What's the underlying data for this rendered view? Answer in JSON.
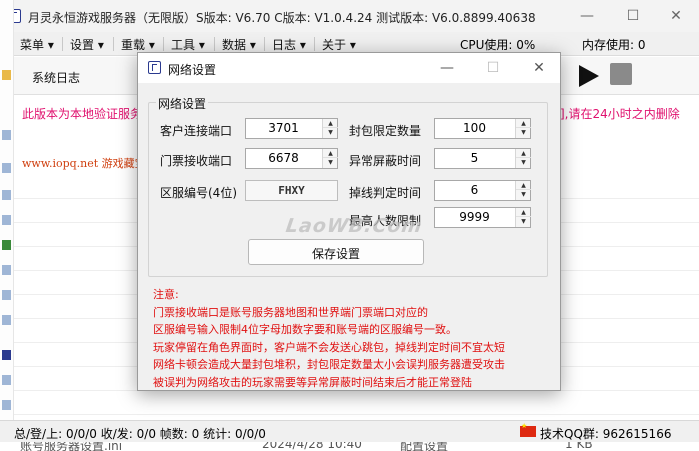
{
  "app": {
    "title": "月灵永恒游戏服务器（无限版）S版本: V6.70 C版本: V1.0.4.24 测试版本: V6.0.8899.40638"
  },
  "menu": {
    "items": [
      "菜单 ▾",
      "设置 ▾",
      "重载 ▾",
      "工具 ▾",
      "数据 ▾",
      "日志 ▾",
      "关于 ▾"
    ],
    "cpu": "CPU使用: 0%",
    "memory": "内存使用: 0"
  },
  "toolbar": {
    "system_log_tab": "系统日志"
  },
  "log": {
    "notice_left": "此版本为本地验证服务",
    "notice_right": "],请在24小时之内删除",
    "site": "www.iopq.net 游戏藏宝"
  },
  "status": {
    "left": "总/登/上: 0/0/0  收/发: 0/0  帧数: 0  统计: 0/0/0",
    "qq": "技术QQ群: 962615166"
  },
  "background_row": {
    "name": "账号服务器设置.ini",
    "date": "2024/4/28 10:40",
    "type": "配置设置",
    "size": "1 KB"
  },
  "dialog": {
    "title": "网络设置",
    "group_label": "网络设置",
    "fields": {
      "client_port": {
        "label": "客户连接端口",
        "value": "3701"
      },
      "ticket_port": {
        "label": "门票接收端口",
        "value": "6678"
      },
      "region_code": {
        "label": "区服编号(4位)",
        "value": "FHXY"
      },
      "packet_limit": {
        "label": "封包限定数量",
        "value": "100"
      },
      "abnormal_block": {
        "label": "异常屏蔽时间",
        "value": "5"
      },
      "disconnect_judge": {
        "label": "掉线判定时间",
        "value": "6"
      },
      "max_online": {
        "label": "最高人数限制",
        "value": "9999"
      }
    },
    "save_button": "保存设置",
    "watermark": "LaoWB.Com",
    "note": {
      "heading": "注意:",
      "lines": [
        "门票接收端口是账号服务器地图和世界端门票端口对应的",
        "区服编号输入限制4位字母加数字要和账号端的区服编号一致。",
        "玩家停留在角色界面时，客户端不会发送心跳包，掉线判定时间不宜太短",
        "网络卡顿会造成大量封包堆积，封包限定数量太小会误判服务器遭受攻击",
        "被误判为网络攻击的玩家需要等异常屏蔽时间结束后才能正常登陆"
      ]
    }
  },
  "colors": {
    "notice": "#e0106e",
    "note": "#e01010",
    "dialog_bg": "#f0f0f0"
  }
}
